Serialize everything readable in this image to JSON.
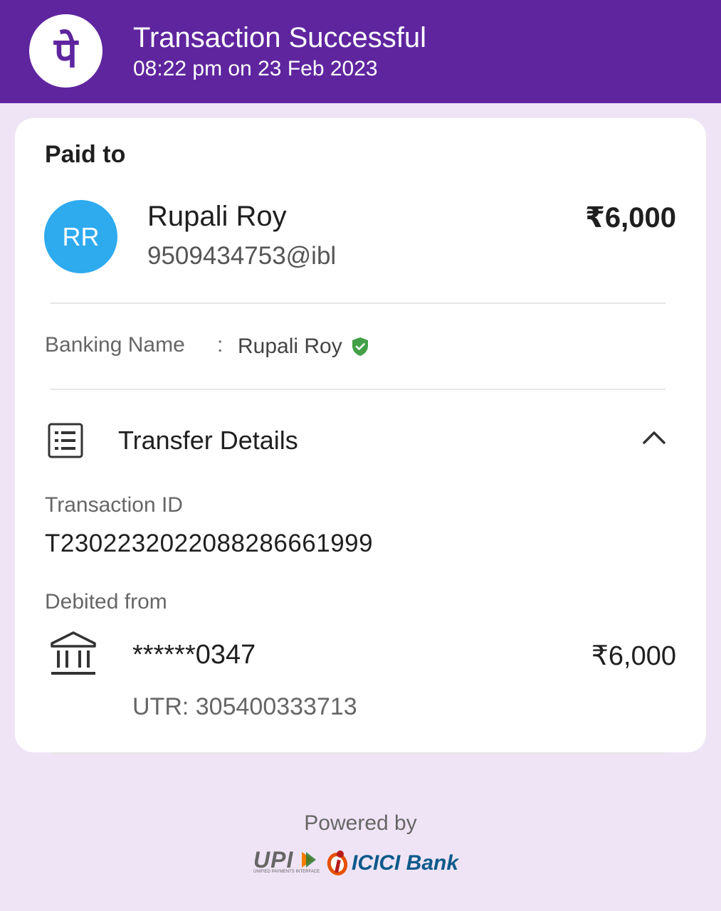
{
  "header": {
    "logo_glyph": "पे",
    "title": "Transaction Successful",
    "datetime": "08:22 pm on 23 Feb 2023",
    "bg_color": "#5f259f"
  },
  "paid_to": {
    "label": "Paid to",
    "avatar_initials": "RR",
    "avatar_color": "#2eaaef",
    "name": "Rupali Roy",
    "upi_id": "9509434753@ibl",
    "amount": "₹6,000"
  },
  "banking_name": {
    "label": "Banking Name",
    "separator": ":",
    "value": "Rupali Roy",
    "verified_icon": "shield-check-icon"
  },
  "transfer_details": {
    "title": "Transfer Details",
    "icon": "receipt-list-icon",
    "toggle_icon": "chevron-up-icon",
    "transaction_id_label": "Transaction ID",
    "transaction_id": "T2302232022088286661999",
    "debited_from_label": "Debited from",
    "account": "******0347",
    "account_icon": "bank-icon",
    "amount": "₹6,000",
    "utr": "UTR: 305400333713"
  },
  "footer": {
    "powered_by": "Powered by",
    "upi_logo_text": "UPI",
    "upi_logo_subtext": "UNIFIED PAYMENTS INTERFACE",
    "bank_logo_text": "ICICI Bank"
  }
}
